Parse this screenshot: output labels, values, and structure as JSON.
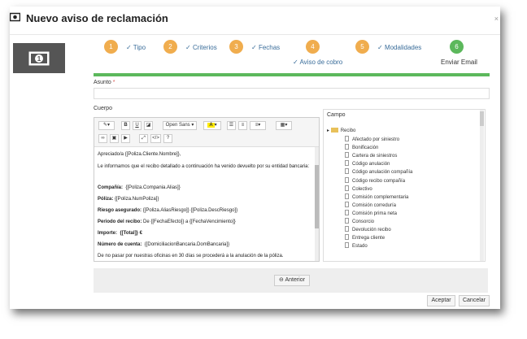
{
  "dialog": {
    "title": "Nuevo aviso de reclamación",
    "close_glyph": "×"
  },
  "wizard": {
    "steps": [
      {
        "number": "1",
        "label": "Tipo",
        "done": true
      },
      {
        "number": "2",
        "label": "Criterios",
        "done": true
      },
      {
        "number": "3",
        "label": "Fechas",
        "done": true
      },
      {
        "number": "4",
        "label": "Aviso de cobro",
        "done": true
      },
      {
        "number": "5",
        "label": "Modalidades",
        "done": true
      },
      {
        "number": "6",
        "label": "Enviar Email",
        "done": false
      }
    ],
    "check_glyph": "✓",
    "progress_percent": 100
  },
  "form": {
    "asunto_label": "Asunto",
    "required_mark": "*",
    "asunto_value": "",
    "cuerpo_label": "Cuerpo"
  },
  "toolbar": {
    "font_name": "Open Sans",
    "dropdown_glyph": "▾",
    "bold": "B",
    "underline": "U",
    "help": "?"
  },
  "body_content": {
    "line1": "Apreciado/a {[Poliza.Cliente.Nombre]},",
    "line2": "Le informamos que el recibo detallado a continuación ha venido devuelto por su entidad bancaria:",
    "compania_label": "Compañía:",
    "compania_value": "{[Poliza.Compania.Alias]}",
    "poliza_label": "Póliza:",
    "poliza_value": "{[Poliza.NumPoliza]}",
    "riesgo_label": "Riesgo asegurado:",
    "riesgo_value": "{[Poliza.AliasRiesgo]} {[Poliza.DescRiesgo]}",
    "periodo_label": "Periodo del recibo:",
    "periodo_value": "De {[FechaEfecto]} a {[FechaVencimiento]}",
    "importe_label": "Importe:",
    "importe_value": "{[Total]} €",
    "cuenta_label": "Número de cuenta:",
    "cuenta_value": "{[DomiciliacionBancaria.DomBancaria]}",
    "last_line": "De no pasar por nuestras oficinas en 30 días se procederá a la anulación de la póliza."
  },
  "tree": {
    "header": "Campo",
    "root": "Recibo",
    "expand_glyph": "▸",
    "items": [
      "Afectado por siniestro",
      "Bonificación",
      "Cartera de siniestros",
      "Código anulación",
      "Código anulación compañía",
      "Código recibo compañía",
      "Colectivo",
      "Comisión complementaria",
      "Comisión correduría",
      "Comisión prima neta",
      "Consorcio",
      "Devolución recibo",
      "Entrega cliente",
      "Estado"
    ]
  },
  "buttons": {
    "anterior": "Anterior",
    "aceptar": "Aceptar",
    "cancelar": "Cancelar"
  },
  "colors": {
    "step_pending": "#f0ad4e",
    "step_active": "#5cb85c",
    "progress": "#5cb85c"
  }
}
